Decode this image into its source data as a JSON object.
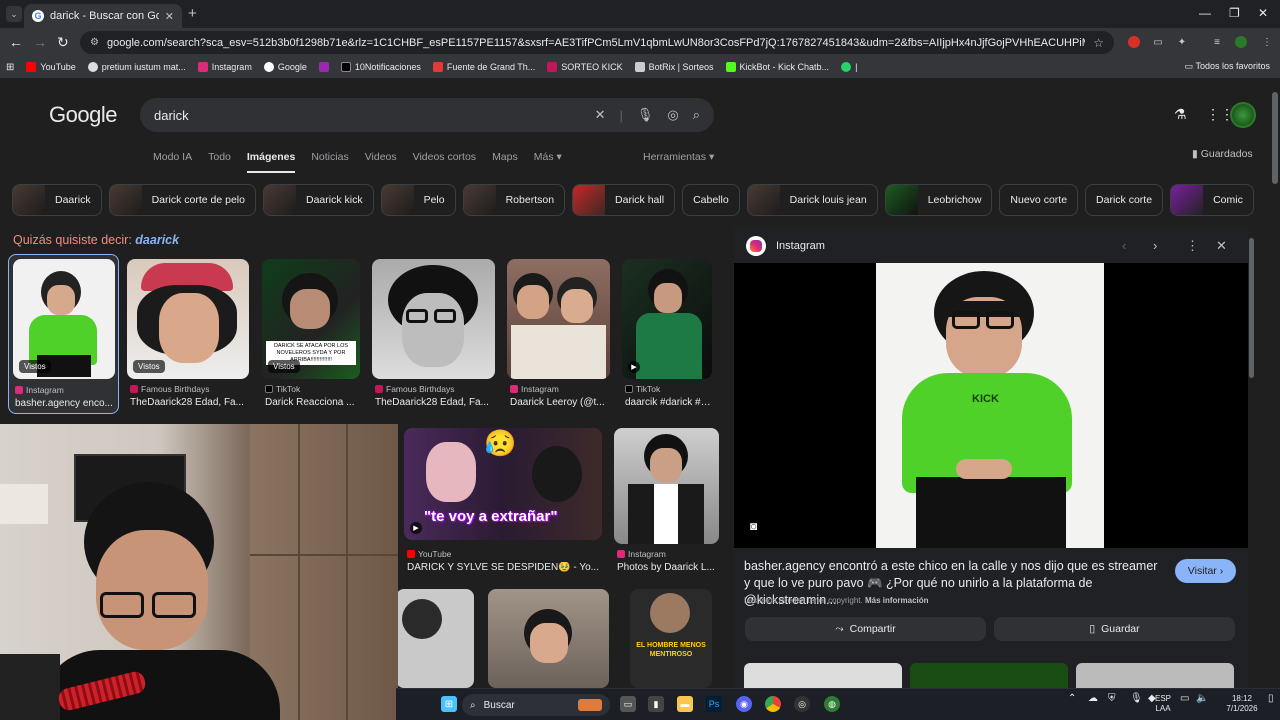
{
  "browser": {
    "tab_title": "darick - Buscar con Google",
    "url": "google.com/search?sca_esv=512b3b0f1298b71e&rlz=1C1CHBF_esPE1157PE1157&sxsrf=AE3TifPCm5LmV1qbmLwUN8or3CosFPd7jQ:1767827451843&udm=2&fbs=AIIjpHx4nJjfGojPVHhEACUHPiMQht6_BFq6vBIoFFRK7qchKHDX9TtpZ992..."
  },
  "bookmarks": {
    "items": [
      "YouTube",
      "pretium iustum mat...",
      "Instagram",
      "Google",
      "",
      "10Notificaciones",
      "Fuente de Grand Th...",
      "SORTEO KICK",
      "BotRix | Sorteos",
      "KickBot - Kick Chatb..."
    ],
    "all_favorites": "Todos los favoritos"
  },
  "google": {
    "logo": "Google",
    "query": "darick",
    "nav": [
      "Modo IA",
      "Todo",
      "Imágenes",
      "Noticias",
      "Videos",
      "Videos cortos",
      "Maps",
      "Más ▾"
    ],
    "tools": "Herramientas ▾",
    "saved": "Guardados",
    "chips": [
      "Daarick",
      "Darick corte de pelo",
      "Daarick kick",
      "Pelo",
      "Robertson",
      "Darick hall",
      "Cabello",
      "Darick louis jean",
      "Leobrichow",
      "Nuevo corte",
      "Darick corte",
      "Comic"
    ],
    "did_you_mean_prefix": "Quizás quisiste decir:",
    "did_you_mean_term": "daarick",
    "seen_badge": "Vistos",
    "results": [
      {
        "source": "Instagram",
        "caption": "basher.agency enco..."
      },
      {
        "source": "Famous Birthdays",
        "caption": "TheDaarick28 Edad, Fa..."
      },
      {
        "source": "TikTok",
        "caption": "Darick Reacciona ..."
      },
      {
        "source": "Famous Birthdays",
        "caption": "TheDaarick28 Edad, Fa..."
      },
      {
        "source": "Instagram",
        "caption": "Daarick Leeroy (@t..."
      },
      {
        "source": "TikTok",
        "caption": "daarcik #darick #th..."
      },
      {
        "source": "YouTube",
        "caption": "DARICK Y SYLVE SE DESPIDEN🥹 - Yo..."
      },
      {
        "source": "Instagram",
        "caption": "Photos by Daarick L..."
      }
    ],
    "overlay_tiktok": "DARICK SE ATACA POR LOS NOVELEROS SYDA Y POR ARRIBA!!!!!!!!!!!!!!",
    "overlay_youtube": "\"te voy a extrañar\"",
    "overlay_bottom": "EL HOMBRE MENOS MENTIROSO"
  },
  "panel": {
    "source": "Instagram",
    "description": "basher.agency encontró a este chico en la calle y nos dijo que es streamer y que lo ve puro pavo 🎮 ¿Por qué no unirlo a la plataforma de @kickstreamin...",
    "visit": "Visitar ›",
    "copyright": "Las fotos pueden tener copyright.",
    "more_info": "Más información",
    "share": "Compartir",
    "save": "Guardar"
  },
  "taskbar": {
    "search": "Buscar",
    "lang1": "ESP",
    "lang2": "LAA",
    "time": "18:12",
    "date": "7/1/2026"
  },
  "colors": {
    "accent": "#8ab4f8",
    "kick_green": "#53fc18",
    "hoodie": "#4fd12a",
    "did_you_mean": "#f28b82"
  }
}
